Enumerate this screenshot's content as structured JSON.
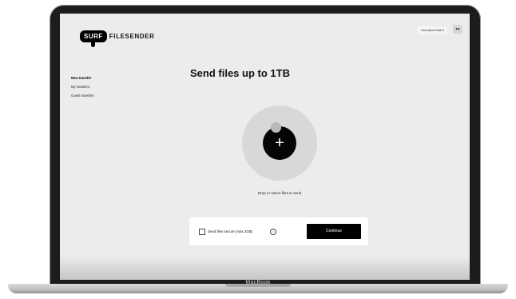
{
  "app": {
    "logo_badge": "SURF",
    "logo_name": "FILESENDER"
  },
  "header": {
    "user_email": "ruben@surfmail.nl",
    "logout_icon": "logout-icon"
  },
  "sidebar": {
    "items": [
      {
        "label": "New transfer",
        "active": true
      },
      {
        "label": "My transfers",
        "active": false
      },
      {
        "label": "Guest transfers",
        "active": false
      }
    ]
  },
  "main": {
    "title": "Send files up to 1TB",
    "dropzone": {
      "icon": "plus-icon",
      "hint": "Drop or select files to send"
    },
    "options": {
      "secure_label": "Send files secure  (max 2GB)",
      "secure_checked": false,
      "info_icon": "info-icon",
      "continue_label": "Continue"
    }
  },
  "device": {
    "label": "MacBook"
  },
  "colors": {
    "screen_bg": "#ececec",
    "primary": "#000000",
    "dropzone_bg": "#d8d8d8"
  }
}
